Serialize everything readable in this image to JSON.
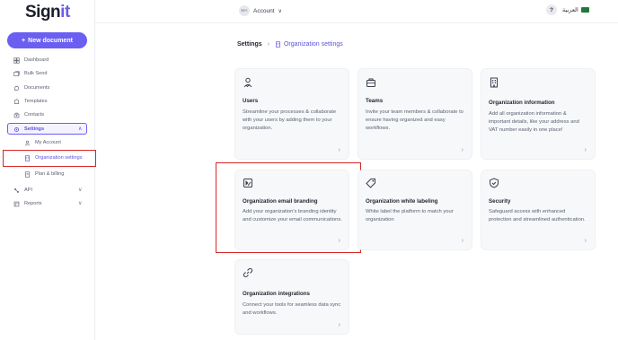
{
  "app": {
    "logo_main": "Sign",
    "logo_accent": "it"
  },
  "sidebar": {
    "new_document": "New document",
    "items": [
      {
        "label": "Dashboard",
        "icon": "grid-icon"
      },
      {
        "label": "Bulk Send",
        "icon": "bulk-send-icon"
      },
      {
        "label": "Documents",
        "icon": "documents-icon"
      },
      {
        "label": "Templates",
        "icon": "templates-icon"
      },
      {
        "label": "Contacts",
        "icon": "contacts-icon"
      },
      {
        "label": "Settings",
        "icon": "gear-icon"
      },
      {
        "label": "My Account",
        "icon": "user-icon"
      },
      {
        "label": "Organization settings",
        "icon": "building-icon"
      },
      {
        "label": "Plan & billing",
        "icon": "billing-icon"
      },
      {
        "label": "API",
        "icon": "api-icon"
      },
      {
        "label": "Reports",
        "icon": "reports-icon"
      }
    ]
  },
  "topbar": {
    "avatar_initials": "MA",
    "account_label": "Account",
    "help_label": "?",
    "language_label": "العربية"
  },
  "breadcrumb": {
    "root": "Settings",
    "current": "Organization settings"
  },
  "cards": [
    {
      "title": "Users",
      "desc": "Streamline your processes & collaborate with your users by adding them to your organization.",
      "icon": "users-icon"
    },
    {
      "title": "Teams",
      "desc": "Invite your team members & collaborate to ensure having organized and easy workflows.",
      "icon": "briefcase-icon"
    },
    {
      "title": "Organization information",
      "desc": "Add all organization information & important details, like your address and VAT number easily in one place!",
      "icon": "building-info-icon"
    },
    {
      "title": "Organization email branding",
      "desc": "Add your organization's branding identity and customize your email communications.",
      "icon": "branding-icon"
    },
    {
      "title": "Organization white labeling",
      "desc": "White label the platform to match your organization",
      "icon": "tag-icon"
    },
    {
      "title": "Security",
      "desc": "Safeguard access with enhanced protection and streamlined authentication.",
      "icon": "shield-icon"
    },
    {
      "title": "Organization integrations",
      "desc": "Connect your tools for seamless data sync and workflows.",
      "icon": "link-icon"
    }
  ],
  "colors": {
    "brand": "#6b5ff2",
    "highlight": "#d62828"
  }
}
